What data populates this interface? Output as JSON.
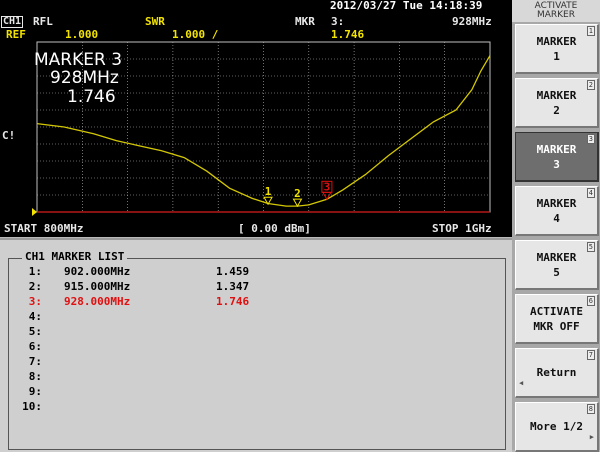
{
  "header": {
    "datetime": "2012/03/27 Tue 14:18:39",
    "channel": "CH1",
    "measurement": "RFL",
    "format": "SWR",
    "marker_label": "MKR",
    "marker_number": "3:",
    "marker_freq": "928MHz",
    "ref_label": "REF",
    "ref_value": "1.000",
    "scale_value": "1.000 /",
    "marker_value": "1.746"
  },
  "screen": {
    "marker_title": "MARKER 3",
    "marker_freq": "928MHz",
    "marker_value": "1.746",
    "side_label": "C!",
    "start": "START 800MHz",
    "power": "[ 0.00 dBm]",
    "stop": "STOP 1GHz",
    "marker_tags": [
      "1",
      "2",
      "3"
    ]
  },
  "chart_data": {
    "type": "line",
    "x_unit": "MHz",
    "xlim": [
      800,
      1000
    ],
    "ylim": [
      1.0,
      11.0
    ],
    "reference": 1.0,
    "series": [
      {
        "x": [
          800,
          812,
          825,
          835,
          845,
          855,
          865,
          875,
          885,
          895,
          902,
          910,
          915,
          920,
          928,
          935,
          945,
          955,
          965,
          975,
          985,
          992,
          996,
          1000
        ],
        "y": [
          6.2,
          6.0,
          5.6,
          5.2,
          4.9,
          4.6,
          4.2,
          3.4,
          2.4,
          1.8,
          1.5,
          1.35,
          1.35,
          1.42,
          1.75,
          2.3,
          3.2,
          4.3,
          5.3,
          6.3,
          7.0,
          8.2,
          9.3,
          10.2
        ]
      }
    ],
    "markers": [
      {
        "label": "1",
        "x": 902,
        "y": 1.459
      },
      {
        "label": "2",
        "x": 915,
        "y": 1.347
      },
      {
        "label": "3",
        "x": 928,
        "y": 1.746
      }
    ],
    "colors": {
      "trace": "#d4c800",
      "grid": "#bfbfbf",
      "reference": "#d81c1c",
      "marker": "#f2e300",
      "active_marker": "#e01010"
    }
  },
  "marker_list": {
    "title": "CH1 MARKER LIST",
    "rows": [
      {
        "num": "1:",
        "freq": "902.000MHz",
        "value": "1.459",
        "active": false
      },
      {
        "num": "2:",
        "freq": "915.000MHz",
        "value": "1.347",
        "active": false
      },
      {
        "num": "3:",
        "freq": "928.000MHz",
        "value": "1.746",
        "active": true
      },
      {
        "num": "4:",
        "freq": "",
        "value": "",
        "active": false
      },
      {
        "num": "5:",
        "freq": "",
        "value": "",
        "active": false
      },
      {
        "num": "6:",
        "freq": "",
        "value": "",
        "active": false
      },
      {
        "num": "7:",
        "freq": "",
        "value": "",
        "active": false
      },
      {
        "num": "8:",
        "freq": "",
        "value": "",
        "active": false
      },
      {
        "num": "9:",
        "freq": "",
        "value": "",
        "active": false
      },
      {
        "num": "10:",
        "freq": "",
        "value": "",
        "active": false
      }
    ]
  },
  "softkeys": {
    "title_line1": "ACTIVATE",
    "title_line2": "MARKER",
    "keys": [
      {
        "line1": "MARKER",
        "line2": "1",
        "num": "1",
        "selected": false
      },
      {
        "line1": "MARKER",
        "line2": "2",
        "num": "2",
        "selected": false
      },
      {
        "line1": "MARKER",
        "line2": "3",
        "num": "3",
        "selected": true
      },
      {
        "line1": "MARKER",
        "line2": "4",
        "num": "4",
        "selected": false
      },
      {
        "line1": "MARKER",
        "line2": "5",
        "num": "5",
        "selected": false
      },
      {
        "line1": "ACTIVATE",
        "line2": "MKR OFF",
        "num": "6",
        "selected": false
      },
      {
        "line1": "Return",
        "line2": "",
        "num": "7",
        "selected": false
      },
      {
        "line1": "More 1/2",
        "line2": "",
        "num": "8",
        "selected": false
      }
    ]
  }
}
